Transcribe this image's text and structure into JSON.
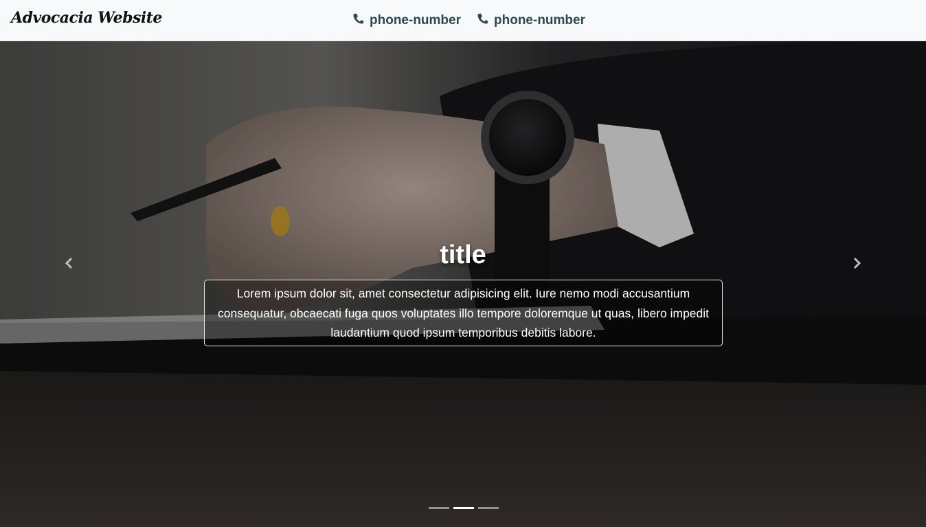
{
  "navbar": {
    "brand": "Advocacia Website",
    "links": [
      {
        "label": "phone-number",
        "icon": "phone-icon"
      },
      {
        "label": "phone-number",
        "icon": "phone-icon"
      }
    ]
  },
  "carousel": {
    "slide": {
      "title": "title",
      "text": "Lorem ipsum dolor sit, amet consectetur adipisicing elit. Iure nemo modi accusantium consequatur, obcaecati fuga quos voluptates illo tempore doloremque ut quas, libero impedit laudantium quod ipsum temporibus debitis labore."
    },
    "indicators": {
      "count": 3,
      "active_index": 1
    }
  },
  "colors": {
    "navbar_bg": "#f8f9fa",
    "nav_link": "#2e4850",
    "caption_border": "#e9ecef"
  }
}
